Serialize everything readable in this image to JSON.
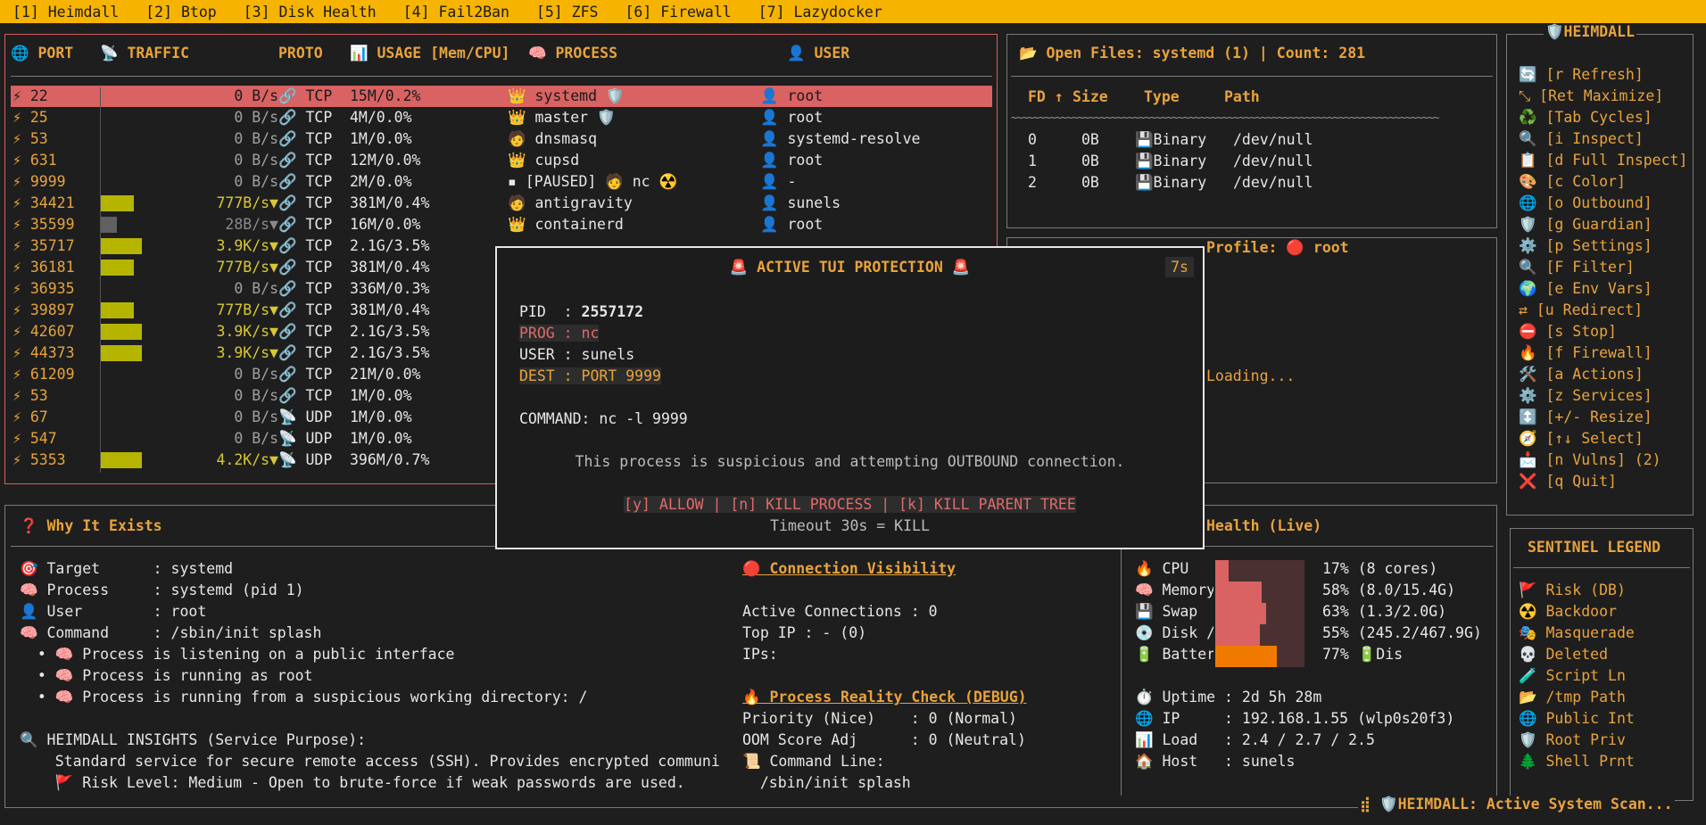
{
  "tabs": [
    "[1] Heimdall",
    "[2] Btop",
    "[3] Disk Health",
    "[4] Fail2Ban",
    "[5] ZFS",
    "[6] Firewall",
    "[7] Lazydocker"
  ],
  "ports": {
    "headers": {
      "port": "🌐 PORT",
      "traffic": "📡 TRAFFIC",
      "proto": "PROTO",
      "usage": "📊 USAGE [Mem/CPU]",
      "process": "🧠 PROCESS",
      "user": "👤 USER"
    },
    "rows": [
      {
        "port": "⚡ 22",
        "traffic": "0 B/s",
        "proto": "🔗 TCP",
        "usage": "15M/0.2%",
        "process": "👑 systemd 🛡️",
        "user": "👤 root",
        "bar": 0,
        "selected": true
      },
      {
        "port": "⚡ 25",
        "traffic": "0 B/s",
        "proto": "🔗 TCP",
        "usage": "4M/0.0%",
        "process": "👑 master 🛡️",
        "user": "👤 root",
        "bar": 0
      },
      {
        "port": "⚡ 53",
        "traffic": "0 B/s",
        "proto": "🔗 TCP",
        "usage": "1M/0.0%",
        "process": "🧑 dnsmasq",
        "user": "👤 systemd-resolve",
        "bar": 0
      },
      {
        "port": "⚡ 631",
        "traffic": "0 B/s",
        "proto": "🔗 TCP",
        "usage": "12M/0.0%",
        "process": "👑 cupsd",
        "user": "👤 root",
        "bar": 0
      },
      {
        "port": "⚡ 9999",
        "traffic": "0 B/s",
        "proto": "🔗 TCP",
        "usage": "2M/0.0%",
        "process": "▪ [PAUSED] 🧑 nc ☢️",
        "user": "👤 -",
        "bar": 0
      },
      {
        "port": "⚡ 34421",
        "traffic": "777B/s▼",
        "proto": "🔗 TCP",
        "usage": "381M/0.4%",
        "process": "🧑 antigravity",
        "user": "👤 sunels",
        "bar": 0.8,
        "yellow": true
      },
      {
        "port": "⚡ 35599",
        "traffic": "28B/s▼",
        "proto": "🔗 TCP",
        "usage": "16M/0.0%",
        "process": "👑 containerd",
        "user": "👤 root",
        "bar": 0.4,
        "dim": true
      },
      {
        "port": "⚡ 35717",
        "traffic": "3.9K/s▼",
        "proto": "🔗 TCP",
        "usage": "2.1G/3.5%",
        "process": "",
        "user": "",
        "bar": 1.0,
        "yellow": true
      },
      {
        "port": "⚡ 36181",
        "traffic": "777B/s▼",
        "proto": "🔗 TCP",
        "usage": "381M/0.4%",
        "process": "",
        "user": "",
        "bar": 0.8,
        "yellow": true
      },
      {
        "port": "⚡ 36935",
        "traffic": "0 B/s",
        "proto": "🔗 TCP",
        "usage": "336M/0.3%",
        "process": "",
        "user": "",
        "bar": 0
      },
      {
        "port": "⚡ 39897",
        "traffic": "777B/s▼",
        "proto": "🔗 TCP",
        "usage": "381M/0.4%",
        "process": "",
        "user": "",
        "bar": 0.8,
        "yellow": true
      },
      {
        "port": "⚡ 42607",
        "traffic": "3.9K/s▼",
        "proto": "🔗 TCP",
        "usage": "2.1G/3.5%",
        "process": "",
        "user": "",
        "bar": 1.0,
        "yellow": true
      },
      {
        "port": "⚡ 44373",
        "traffic": "3.9K/s▼",
        "proto": "🔗 TCP",
        "usage": "2.1G/3.5%",
        "process": "",
        "user": "",
        "bar": 1.0,
        "yellow": true
      },
      {
        "port": "⚡ 61209",
        "traffic": "0 B/s",
        "proto": "🔗 TCP",
        "usage": "21M/0.0%",
        "process": "",
        "user": "",
        "bar": 0
      },
      {
        "port": "⚡ 53",
        "traffic": "0 B/s",
        "proto": "🔗 TCP",
        "usage": "1M/0.0%",
        "process": "",
        "user": "",
        "bar": 0
      },
      {
        "port": "⚡ 67",
        "traffic": "0 B/s",
        "proto": "📡 UDP",
        "usage": "1M/0.0%",
        "process": "",
        "user": "",
        "bar": 0
      },
      {
        "port": "⚡ 547",
        "traffic": "0 B/s",
        "proto": "📡 UDP",
        "usage": "1M/0.0%",
        "process": "",
        "user": "",
        "bar": 0
      },
      {
        "port": "⚡ 5353",
        "traffic": "4.2K/s▼",
        "proto": "📡 UDP",
        "usage": "396M/0.7%",
        "process": "",
        "user": "",
        "bar": 1.0,
        "yellow": true
      }
    ]
  },
  "open_files": {
    "title": "📂 Open Files: systemd (1) | Count: 281",
    "headers": {
      "fd": "FD ↑",
      "size": "Size",
      "type": "Type",
      "path": "Path"
    },
    "separator": "~~~~~~~~~~~~~~~~~~~~~~~~~~~~~~~~~~~~~~~~~~~~~~~~~~~~~~~~~~~~~~~~~~~~~~~~~~~~~",
    "rows": [
      {
        "fd": "0",
        "size": "0B",
        "type": "💾Binary",
        "path": "/dev/null"
      },
      {
        "fd": "1",
        "size": "0B",
        "type": "💾Binary",
        "path": "/dev/null"
      },
      {
        "fd": "2",
        "size": "0B",
        "type": "💾Binary",
        "path": "/dev/null"
      }
    ]
  },
  "profile": {
    "title": "Profile: 🔴 root",
    "loading": "Loading..."
  },
  "modal": {
    "title": "🚨 ACTIVE TUI PROTECTION 🚨",
    "timer": "7s",
    "pid_label": "PID  : ",
    "pid": "2557172",
    "prog": "PROG : nc",
    "user_label": "USER : ",
    "user": "sunels",
    "dest": "DEST : PORT 9999",
    "command": "COMMAND: nc -l 9999",
    "message": "This process is suspicious and attempting OUTBOUND connection.",
    "actions": "[y] ALLOW | [n] KILL PROCESS | [k] KILL PARENT TREE",
    "timeout": "Timeout 30s = KILL"
  },
  "why": {
    "title": "❓ Why It Exists",
    "lines": [
      "🎯 Target      : systemd",
      "🧠 Process     : systemd (pid 1)",
      "👤 User        : root",
      "🧠 Command     : /sbin/init splash",
      "  • 🧠 Process is listening on a public interface",
      "  • 🧠 Process is running as root",
      "  • 🧠 Process is running from a suspicious working directory: /"
    ],
    "insights_title": "🔍 HEIMDALL INSIGHTS (Service Purpose):",
    "insights_text": "    Standard service for secure remote access (SSH). Provides encrypted communi",
    "risk": "    🚩 Risk Level: Medium - Open to brute-force if weak passwords are used."
  },
  "connection": {
    "title": "🔴 Connection Visibility",
    "active": "Active Connections : 0",
    "top_ip": "Top IP : - (0)",
    "ips": "IPs:",
    "reality_title": "🔥 Process Reality Check (DEBUG)",
    "priority": "Priority (Nice)    : 0 (Normal)",
    "oom": "OOM Score Adj      : 0 (Neutral)",
    "cmdline_label": "📜 Command Line:",
    "cmdline": "  /sbin/init splash"
  },
  "health": {
    "title": "Health (Live)",
    "gauges": [
      {
        "label": "🔥 CPU",
        "value": 0.17,
        "text": "17% (8 cores)",
        "color": "#d96262"
      },
      {
        "label": "🧠 Memory",
        "value": 0.58,
        "text": "58% (8.0/15.4G)",
        "color": "#d96262"
      },
      {
        "label": "💾 Swap",
        "value": 0.63,
        "text": "63% (1.3/2.0G)",
        "color": "#d96262"
      },
      {
        "label": "💿 Disk /",
        "value": 0.55,
        "text": "55% (245.2/467.9G)",
        "color": "#d96262"
      },
      {
        "label": "🔋 Batter",
        "value": 0.77,
        "text": "77% 🔋Dis",
        "color": "#f07a00"
      }
    ],
    "uptime": "⏱️ Uptime : 2d 5h 28m",
    "ip": "🌐 IP     : 192.168.1.55 (wlp0s20f3)",
    "load": "📊 Load   : 2.4 / 2.7 / 2.5",
    "host": "🏠 Host   : sunels"
  },
  "sidebar": {
    "title": "🛡️HEIMDALL",
    "actions": [
      "🔄 [r Refresh]",
      "⤡ [Ret Maximize]",
      "♻️ [Tab Cycles]",
      "🔍 [i Inspect]",
      "📋 [d Full Inspect]",
      "🎨 [c Color]",
      "🌐 [o Outbound]",
      "🛡️ [g Guardian]",
      "⚙️ [p Settings]",
      "🔍 [F Filter]",
      "🌍 [e Env Vars]",
      "⇄ [u Redirect]",
      "⛔ [s Stop]",
      "🔥 [f Firewall]",
      "🛠️ [a Actions]",
      "⚙️ [z Services]",
      "↕️ [+/- Resize]",
      "🧭 [↑↓ Select]",
      "📩 [n Vulns] (2)",
      "❌ [q Quit]"
    ],
    "legend_title": "SENTINEL LEGEND",
    "legend": [
      "🚩 Risk (DB)",
      "☢️ Backdoor",
      "🎭 Masquerade",
      "💀 Deleted",
      "🧪 Script Ln",
      "📂 /tmp Path",
      "🌐 Public Int",
      "🛡️ Root Priv",
      "🌲 Shell Prnt"
    ]
  },
  "statusbar": "⣾ 🛡️HEIMDALL: Active System Scan..."
}
